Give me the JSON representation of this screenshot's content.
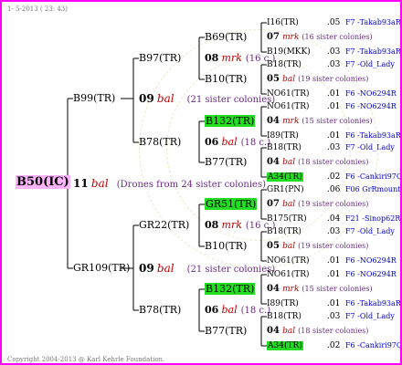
{
  "header": "1-  5-2013 ( 23: 43)",
  "footer": "Copyright 2004-2013 @ Karl Kehrle Foundation.",
  "root": {
    "label": "B50(IC)",
    "gen": "11",
    "mark": "bal",
    "note": "(Drones from 24 sister colonies)"
  },
  "gen1": [
    {
      "label": "B99(TR)",
      "gen": "09",
      "mark": "bal",
      "note": "(21 sister colonies)"
    },
    {
      "label": "GR109(TR)",
      "gen": "09",
      "mark": "bal",
      "note": "(21 sister colonies)"
    }
  ],
  "gen2": [
    {
      "label": "B97(TR)",
      "gen": "08",
      "mark": "mrk",
      "note": "(16 c.)"
    },
    {
      "label": "B78(TR)",
      "gen": "06",
      "mark": "bal",
      "note": "(18 c.)"
    },
    {
      "label": "GR22(TR)",
      "gen": "08",
      "mark": "mrk",
      "note": "(16 c.)"
    },
    {
      "label": "B78(TR)",
      "gen": "06",
      "mark": "bal",
      "note": "(18 c.)"
    }
  ],
  "gen3": [
    {
      "label": "B69(TR)",
      "gen": "07",
      "mark": "mrk",
      "note": "(16 sister colonies)",
      "hl": false
    },
    {
      "label": "B10(TR)",
      "gen": "05",
      "mark": "bal",
      "note": "(19 sister colonies)",
      "hl": false
    },
    {
      "label": "B132(TR)",
      "gen": "04",
      "mark": "mrk",
      "note": "(15 sister colonies)",
      "hl": true
    },
    {
      "label": "B77(TR)",
      "gen": "04",
      "mark": "bal",
      "note": "(18 sister colonies)",
      "hl": false
    },
    {
      "label": "GR51(TR)",
      "gen": "07",
      "mark": "bal",
      "note": "(19 sister colonies)",
      "hl": true
    },
    {
      "label": "B10(TR)",
      "gen": "05",
      "mark": "bal",
      "note": "(19 sister colonies)",
      "hl": false
    },
    {
      "label": "B132(TR)",
      "gen": "04",
      "mark": "mrk",
      "note": "(15 sister colonies)",
      "hl": true
    },
    {
      "label": "B77(TR)",
      "gen": "04",
      "mark": "bal",
      "note": "(18 sister colonies)",
      "hl": false
    }
  ],
  "gen4": [
    {
      "label": "I16(TR)",
      "year": ".05",
      "loc": "F7 -Takab93aR",
      "hl": false
    },
    {
      "label": "B19(MKK)",
      "year": ".03",
      "loc": "F7 -Takab93aR",
      "hl": false
    },
    {
      "label": "B18(TR)",
      "year": ".03",
      "loc": "F7 -Old_Lady",
      "hl": false
    },
    {
      "label": "NO61(TR)",
      "year": ".01",
      "loc": "F6 -NO6294R",
      "hl": false
    },
    {
      "label": "NO61(TR)",
      "year": ".01",
      "loc": "F6 -NO6294R",
      "hl": false
    },
    {
      "label": "I89(TR)",
      "year": ".01",
      "loc": "F6 -Takab93aR",
      "hl": false
    },
    {
      "label": "B18(TR)",
      "year": ".03",
      "loc": "F7 -Old_Lady",
      "hl": false
    },
    {
      "label": "A34(TR)",
      "year": ".02",
      "loc": "F6 -Cankiri97Q",
      "hl": true
    },
    {
      "label": "GR1(PN)",
      "year": ".06",
      "loc": "F06 GrRmountain06Q",
      "hl": false
    },
    {
      "label": "B175(TR)",
      "year": ".04",
      "loc": "F21 -Sinop62R",
      "hl": false
    },
    {
      "label": "B18(TR)",
      "year": ".03",
      "loc": "F7 -Old_Lady",
      "hl": false
    },
    {
      "label": "NO61(TR)",
      "year": ".01",
      "loc": "F6 -NO6294R",
      "hl": false
    },
    {
      "label": "NO61(TR)",
      "year": ".01",
      "loc": "F6 -NO6294R",
      "hl": false
    },
    {
      "label": "I89(TR)",
      "year": ".01",
      "loc": "F6 -Takab93aR",
      "hl": false
    },
    {
      "label": "B18(TR)",
      "year": ".03",
      "loc": "F7 -Old_Lady",
      "hl": false
    },
    {
      "label": "A34(TR)",
      "year": ".02",
      "loc": "F6 -Cankiri97Q",
      "hl": true
    }
  ]
}
